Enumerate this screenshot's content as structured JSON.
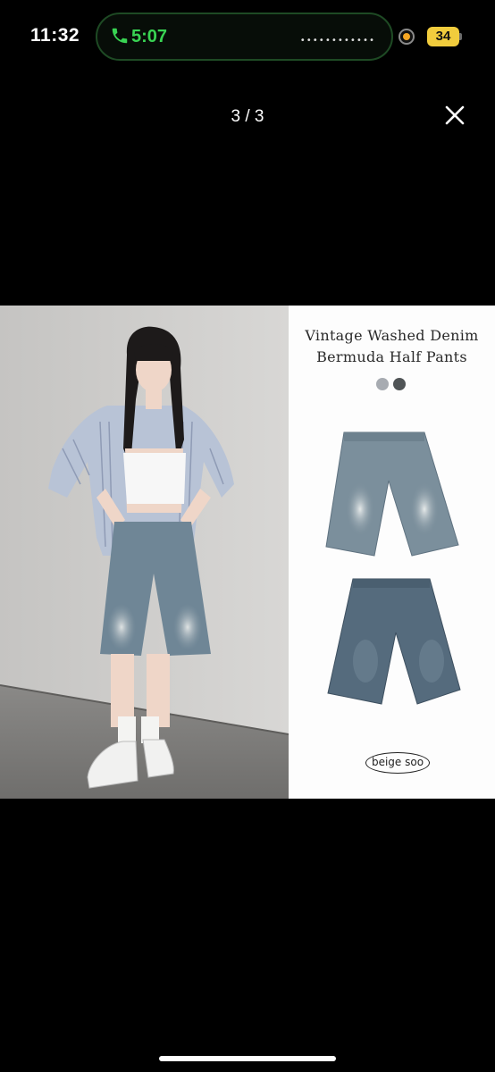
{
  "status_bar": {
    "time": "11:32",
    "call_timer": "5:07",
    "battery": "34"
  },
  "viewer": {
    "page_counter": "3 / 3",
    "close_icon": "close-icon"
  },
  "product": {
    "title_line1": "Vintage Washed Denim",
    "title_line2": "Bermuda Half Pants",
    "swatches": [
      "#a7abb1",
      "#505456"
    ],
    "brand": "beige soo"
  },
  "colors": {
    "background": "#000000",
    "call_green": "#39d353",
    "battery_yellow": "#f1cc3d"
  }
}
